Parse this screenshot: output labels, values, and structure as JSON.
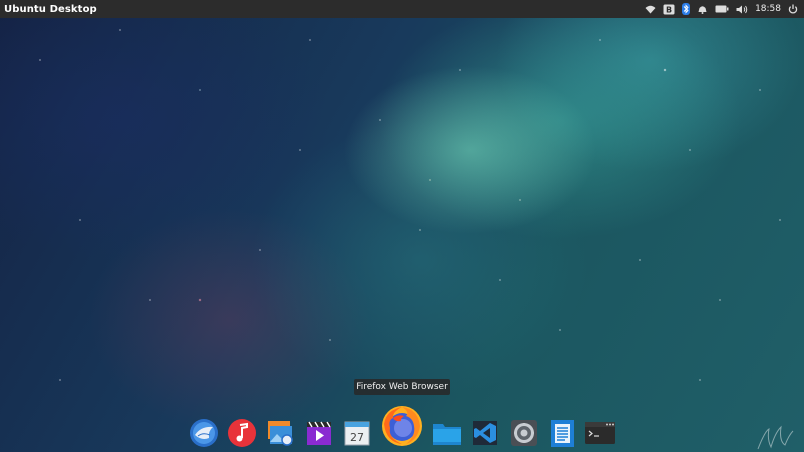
{
  "top_panel": {
    "app_title": "Ubuntu Desktop",
    "clock": "18:58",
    "indicators": [
      "wifi-icon",
      "keyboard-layout-icon",
      "bluetooth-icon",
      "alarm-icon",
      "battery-icon",
      "volume-icon",
      "power-icon"
    ]
  },
  "dock": {
    "tooltip": "Firefox Web Browser",
    "calendar_day": "27",
    "items": [
      "thunderbird-mail-icon",
      "music-player-icon",
      "image-viewer-icon",
      "video-player-icon",
      "calendar-icon",
      "firefox-icon",
      "files-icon",
      "vscode-icon",
      "system-settings-icon",
      "text-editor-icon",
      "terminal-icon"
    ]
  },
  "colors": {
    "panel": "#2c2c2c",
    "accent_firefox": "#ff7a1a",
    "folder_blue": "#2aa3e8"
  }
}
